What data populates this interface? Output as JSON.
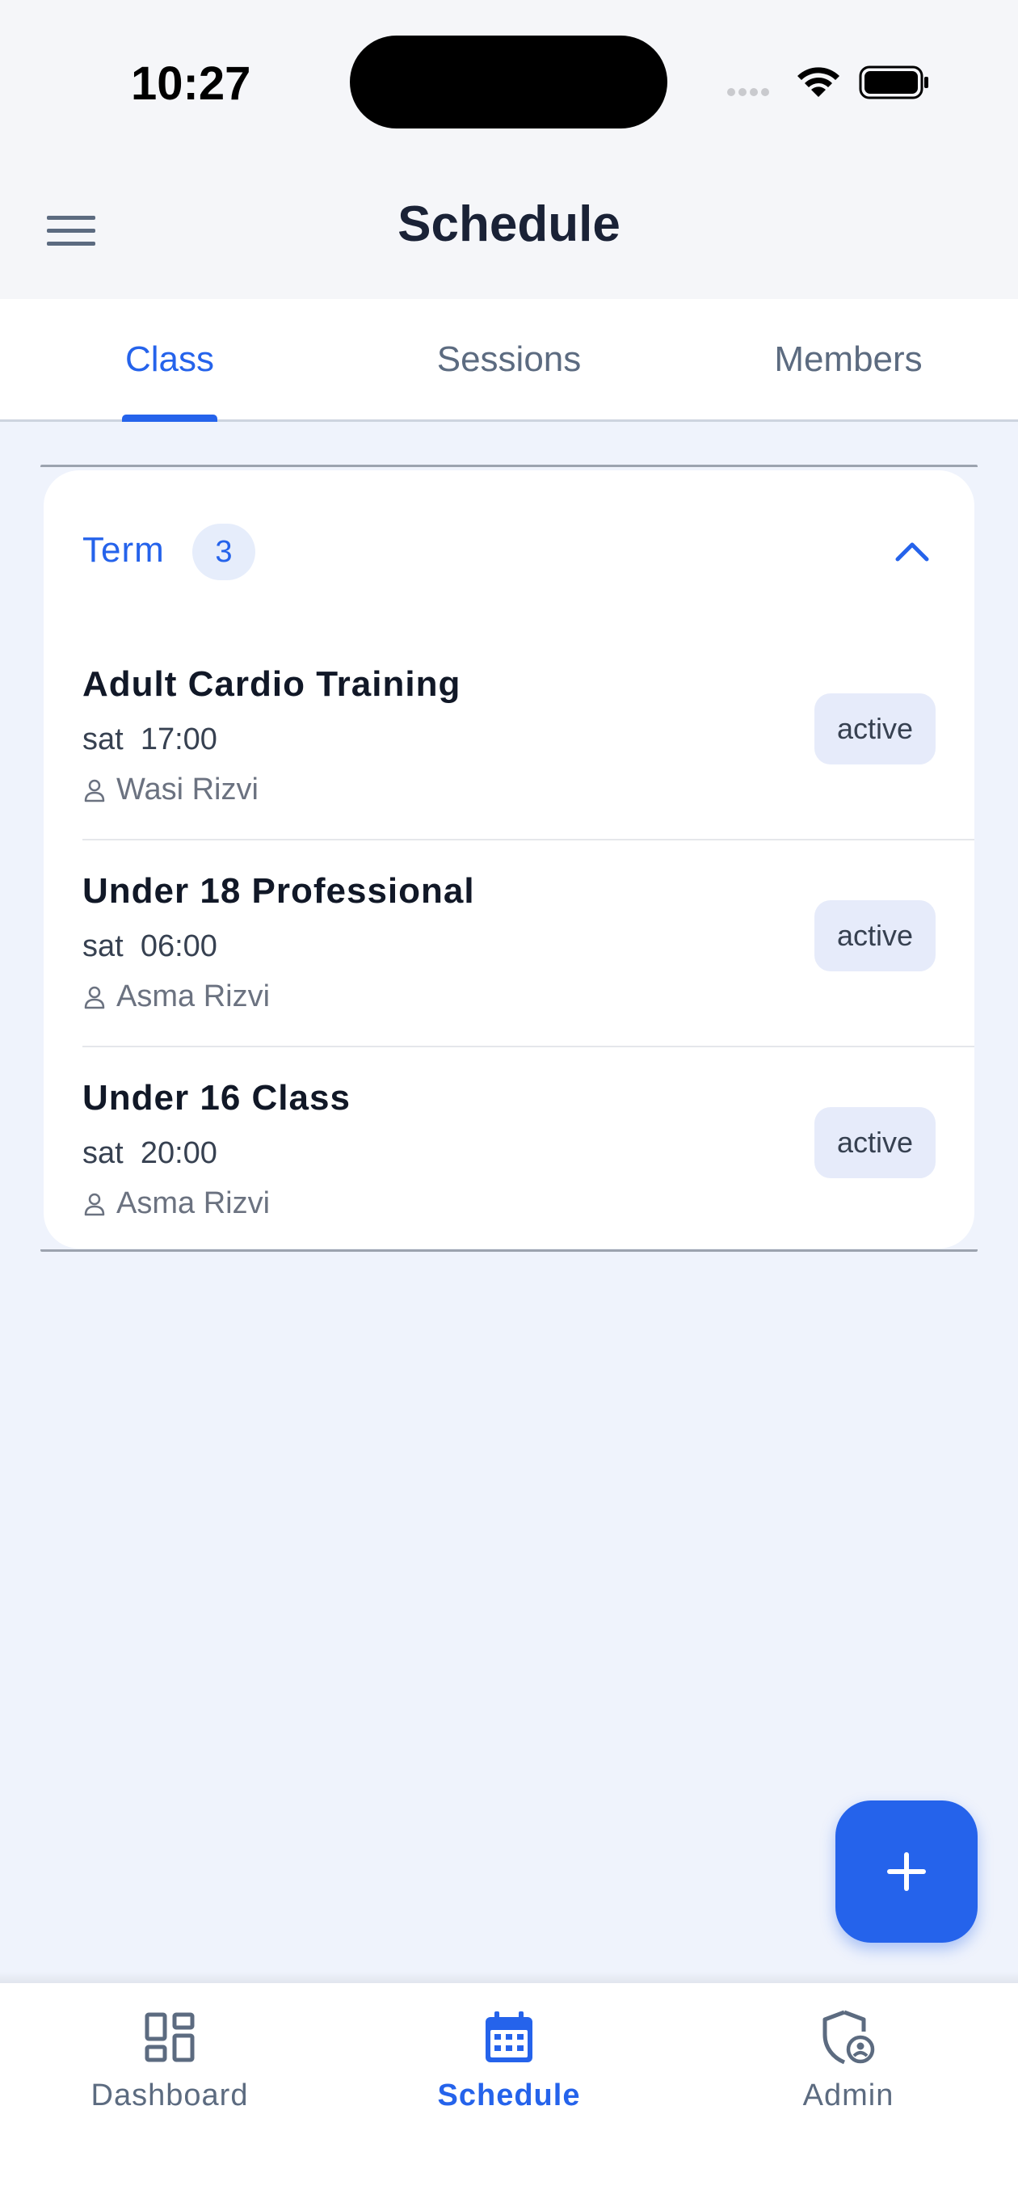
{
  "status_bar": {
    "time": "10:27"
  },
  "header": {
    "title": "Schedule",
    "menu_icon": "hamburger-menu-icon"
  },
  "tabs": [
    {
      "label": "Class",
      "active": true
    },
    {
      "label": "Sessions",
      "active": false
    },
    {
      "label": "Members",
      "active": false
    }
  ],
  "term_group": {
    "label": "Term",
    "count": "3",
    "classes": [
      {
        "name": "Adult Cardio Training",
        "day": "sat",
        "time": "17:00",
        "instructor": "Wasi Rizvi",
        "status": "active"
      },
      {
        "name": "Under 18 Professional",
        "day": "sat",
        "time": "06:00",
        "instructor": "Asma Rizvi",
        "status": "active"
      },
      {
        "name": "Under 16 Class",
        "day": "sat",
        "time": "20:00",
        "instructor": "Asma Rizvi",
        "status": "active"
      }
    ]
  },
  "bottom_nav": [
    {
      "label": "Dashboard",
      "icon": "dashboard-icon",
      "active": false
    },
    {
      "label": "Schedule",
      "icon": "calendar-icon",
      "active": true
    },
    {
      "label": "Admin",
      "icon": "admin-shield-icon",
      "active": false
    }
  ],
  "colors": {
    "accent": "#2563EB",
    "background": "#EFF3FC",
    "muted": "#5C6B80"
  }
}
